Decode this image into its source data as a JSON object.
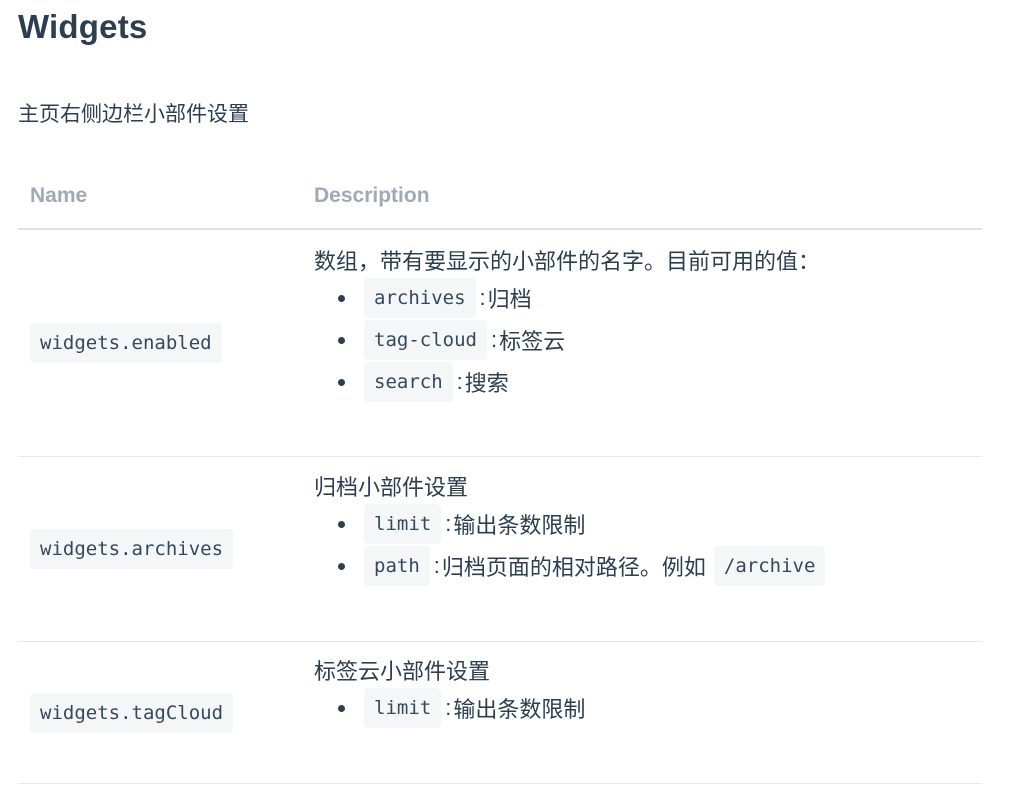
{
  "title": "Widgets",
  "subtitle": "主页右侧边栏小部件设置",
  "table": {
    "headers": [
      "Name",
      "Description"
    ],
    "rows": [
      {
        "name": "widgets.enabled",
        "desc": "数组，带有要显示的小部件的名字。目前可用的值：",
        "items": [
          {
            "code": "archives",
            "text": "归档"
          },
          {
            "code": "tag-cloud",
            "text": "标签云"
          },
          {
            "code": "search",
            "text": "搜索"
          }
        ]
      },
      {
        "name": "widgets.archives",
        "desc": "归档小部件设置",
        "items": [
          {
            "code": "limit",
            "text": "输出条数限制"
          },
          {
            "code": "path",
            "text": "归档页面的相对路径。例如",
            "extra_code": "/archive"
          }
        ]
      },
      {
        "name": "widgets.tagCloud",
        "desc": "标签云小部件设置",
        "items": [
          {
            "code": "limit",
            "text": "输出条数限制"
          }
        ]
      }
    ]
  }
}
